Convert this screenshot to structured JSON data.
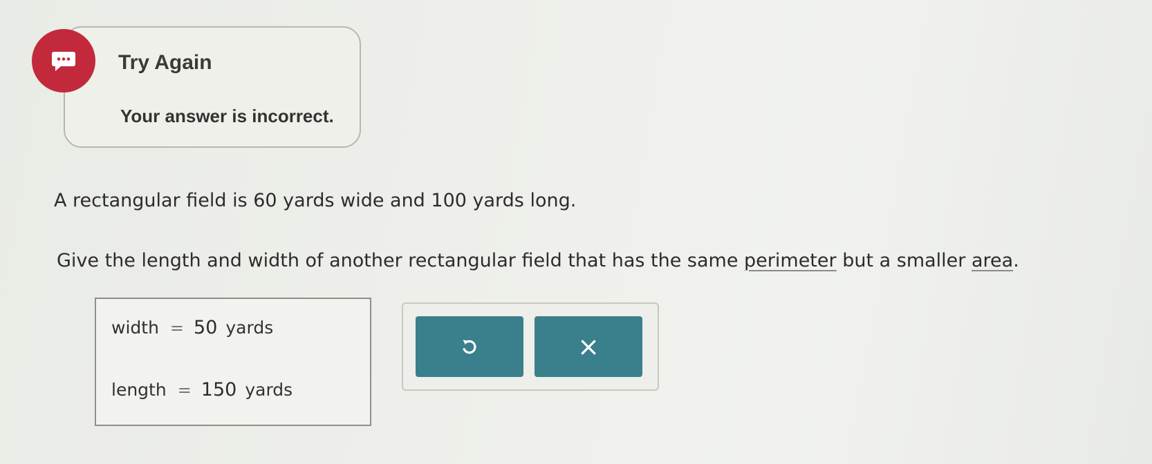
{
  "feedback": {
    "title": "Try Again",
    "message": "Your answer is incorrect.",
    "icon": "chat-bubble-icon",
    "badge_color": "#c22a3c"
  },
  "problem": {
    "line1": "A rectangular field is 60 yards wide and 100 yards long.",
    "line2_prefix": "Give the length and width of another rectangular field that has the same ",
    "term_perimeter": "perimeter",
    "line2_middle": " but a smaller ",
    "term_area": "area",
    "line2_suffix": "."
  },
  "answer": {
    "width_label": "width",
    "width_value": "50",
    "width_unit": "yards",
    "length_label": "length",
    "length_value": "150",
    "length_unit": "yards",
    "equals": "="
  },
  "actions": {
    "undo_icon": "undo-icon",
    "clear_symbol": "×",
    "button_color": "#3a7f8c"
  }
}
